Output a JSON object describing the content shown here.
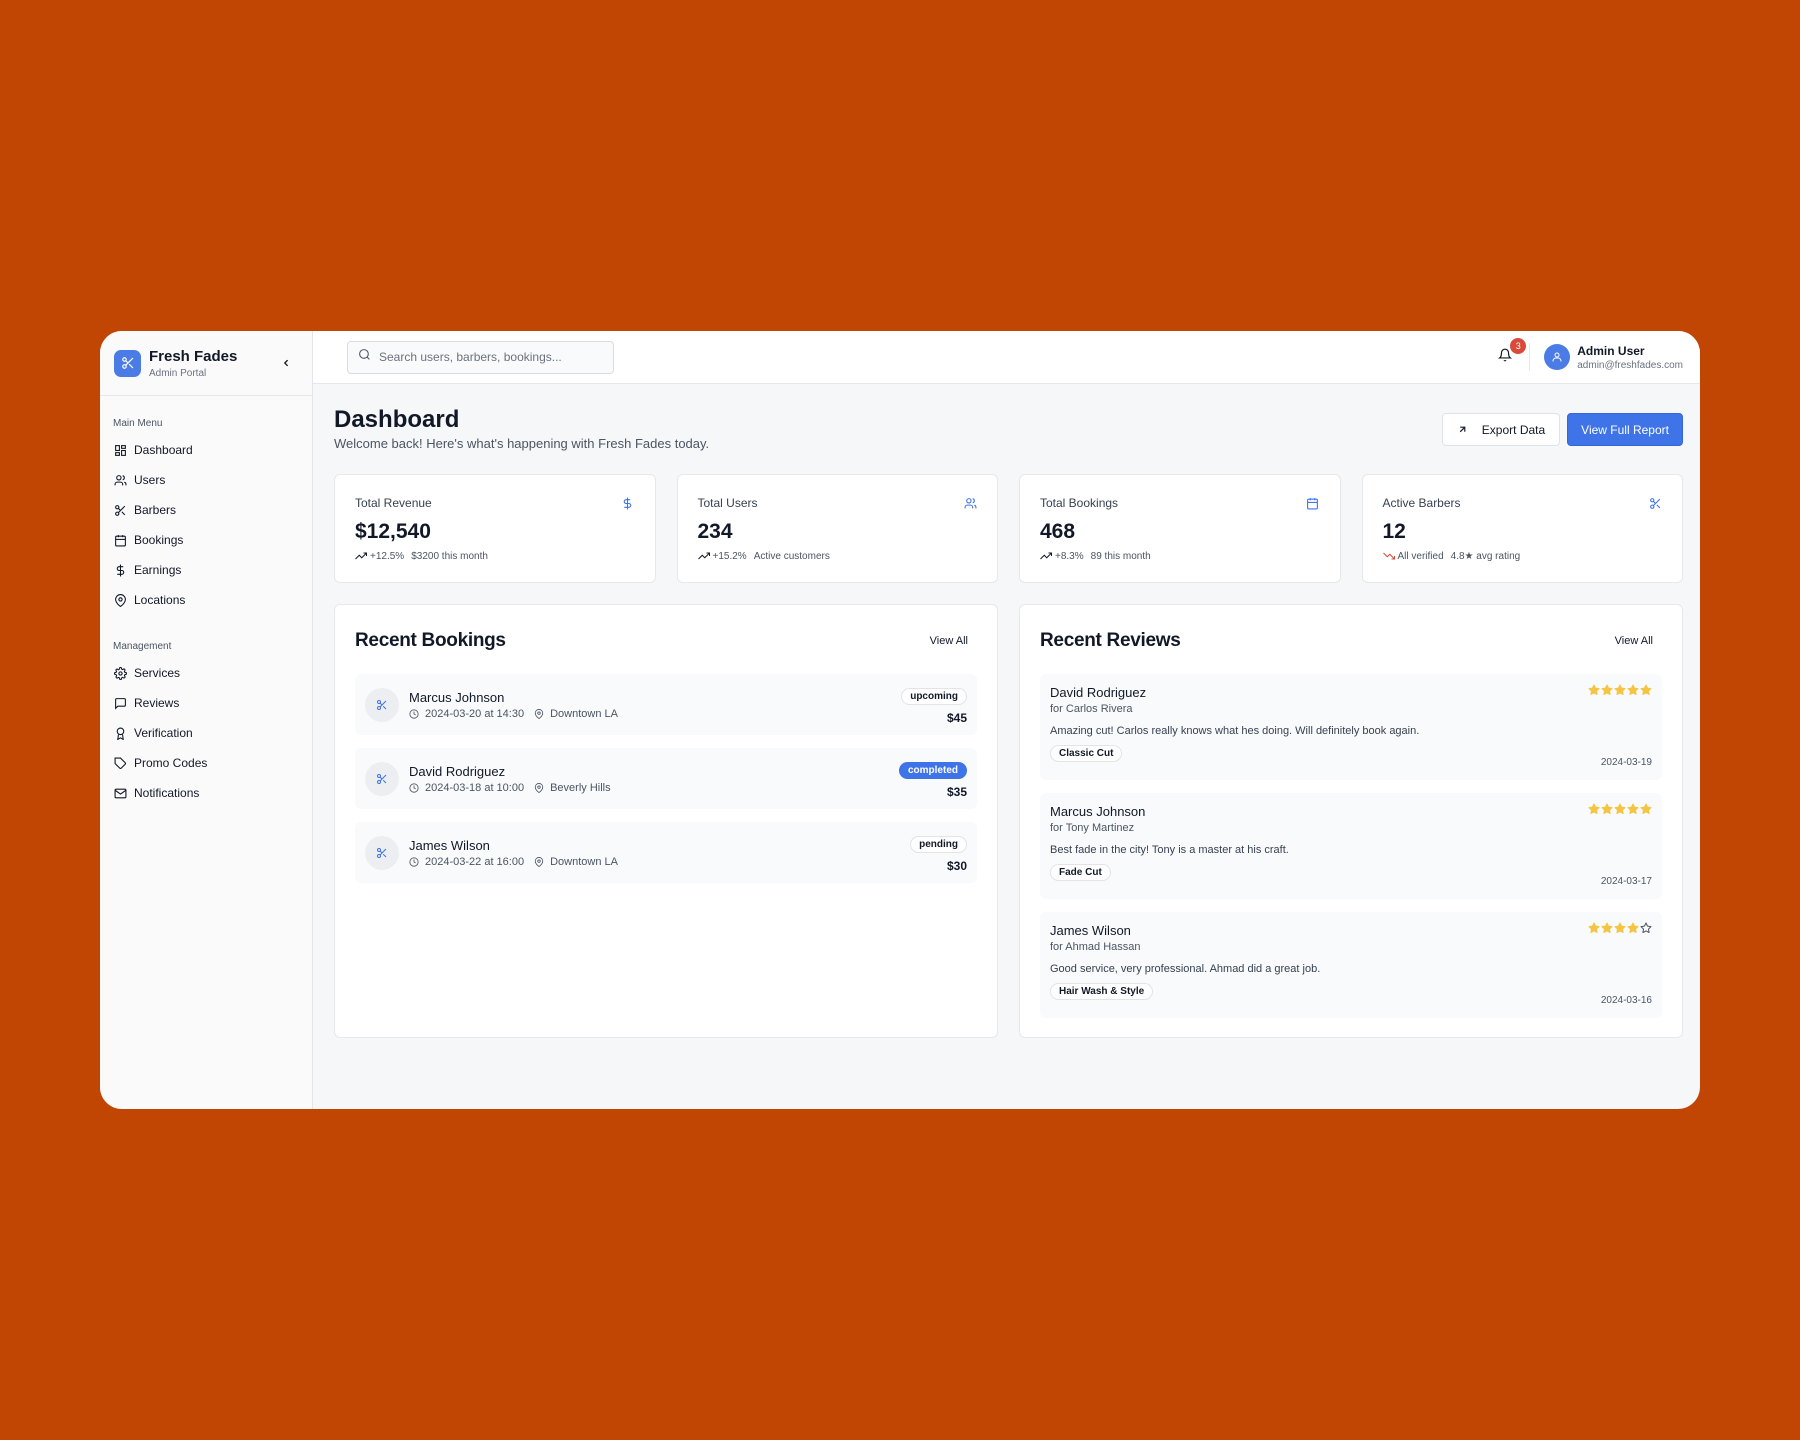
{
  "brand": {
    "name": "Fresh Fades",
    "subtitle": "Admin Portal"
  },
  "sidebar": {
    "groups": [
      {
        "title": "Main Menu",
        "items": [
          {
            "label": "Dashboard",
            "icon": "dashboard-icon"
          },
          {
            "label": "Users",
            "icon": "users-icon"
          },
          {
            "label": "Barbers",
            "icon": "scissors-icon"
          },
          {
            "label": "Bookings",
            "icon": "calendar-icon"
          },
          {
            "label": "Earnings",
            "icon": "dollar-icon"
          },
          {
            "label": "Locations",
            "icon": "map-pin-icon"
          }
        ]
      },
      {
        "title": "Management",
        "items": [
          {
            "label": "Services",
            "icon": "gear-icon"
          },
          {
            "label": "Reviews",
            "icon": "message-icon"
          },
          {
            "label": "Verification",
            "icon": "award-icon"
          },
          {
            "label": "Promo Codes",
            "icon": "tag-icon"
          },
          {
            "label": "Notifications",
            "icon": "mail-icon"
          }
        ]
      }
    ]
  },
  "topbar": {
    "search_placeholder": "Search users, barbers, bookings...",
    "notification_count": "3",
    "user_name": "Admin User",
    "user_email": "admin@freshfades.com"
  },
  "header": {
    "title": "Dashboard",
    "subtitle": "Welcome back! Here's what's happening with Fresh Fades today.",
    "export_label": "Export Data",
    "report_label": "View Full Report"
  },
  "stats": [
    {
      "label": "Total Revenue",
      "value": "$12,540",
      "trend": "+12.5%",
      "note": "$3200 this month",
      "icon": "dollar-icon",
      "trend_dir": "up"
    },
    {
      "label": "Total Users",
      "value": "234",
      "trend": "+15.2%",
      "note": "Active customers",
      "icon": "users-icon",
      "trend_dir": "up"
    },
    {
      "label": "Total Bookings",
      "value": "468",
      "trend": "+8.3%",
      "note": "89 this month",
      "icon": "calendar-icon",
      "trend_dir": "up"
    },
    {
      "label": "Active Barbers",
      "value": "12",
      "trend": "All verified",
      "note": "4.8★ avg rating",
      "icon": "scissors-icon",
      "trend_dir": "down"
    }
  ],
  "bookings": {
    "title": "Recent Bookings",
    "view_all": "View All",
    "items": [
      {
        "name": "Marcus Johnson",
        "datetime": "2024-03-20 at 14:30",
        "location": "Downtown LA",
        "status": "upcoming",
        "price": "$45"
      },
      {
        "name": "David Rodriguez",
        "datetime": "2024-03-18 at 10:00",
        "location": "Beverly Hills",
        "status": "completed",
        "price": "$35"
      },
      {
        "name": "James Wilson",
        "datetime": "2024-03-22 at 16:00",
        "location": "Downtown LA",
        "status": "pending",
        "price": "$30"
      }
    ]
  },
  "reviews": {
    "title": "Recent Reviews",
    "view_all": "View All",
    "items": [
      {
        "name": "David Rodriguez",
        "barber": "for Carlos Rivera",
        "text": "Amazing cut! Carlos really knows what hes doing. Will definitely book again.",
        "service": "Classic Cut",
        "date": "2024-03-19",
        "rating": 5
      },
      {
        "name": "Marcus Johnson",
        "barber": "for Tony Martinez",
        "text": "Best fade in the city! Tony is a master at his craft.",
        "service": "Fade Cut",
        "date": "2024-03-17",
        "rating": 5
      },
      {
        "name": "James Wilson",
        "barber": "for Ahmad Hassan",
        "text": "Good service, very professional. Ahmad did a great job.",
        "service": "Hair Wash & Style",
        "date": "2024-03-16",
        "rating": 4
      }
    ]
  },
  "colors": {
    "background": "#c24603",
    "accent": "#3f73e8",
    "star": "#f4c542",
    "trend_down": "#d94a3a"
  }
}
